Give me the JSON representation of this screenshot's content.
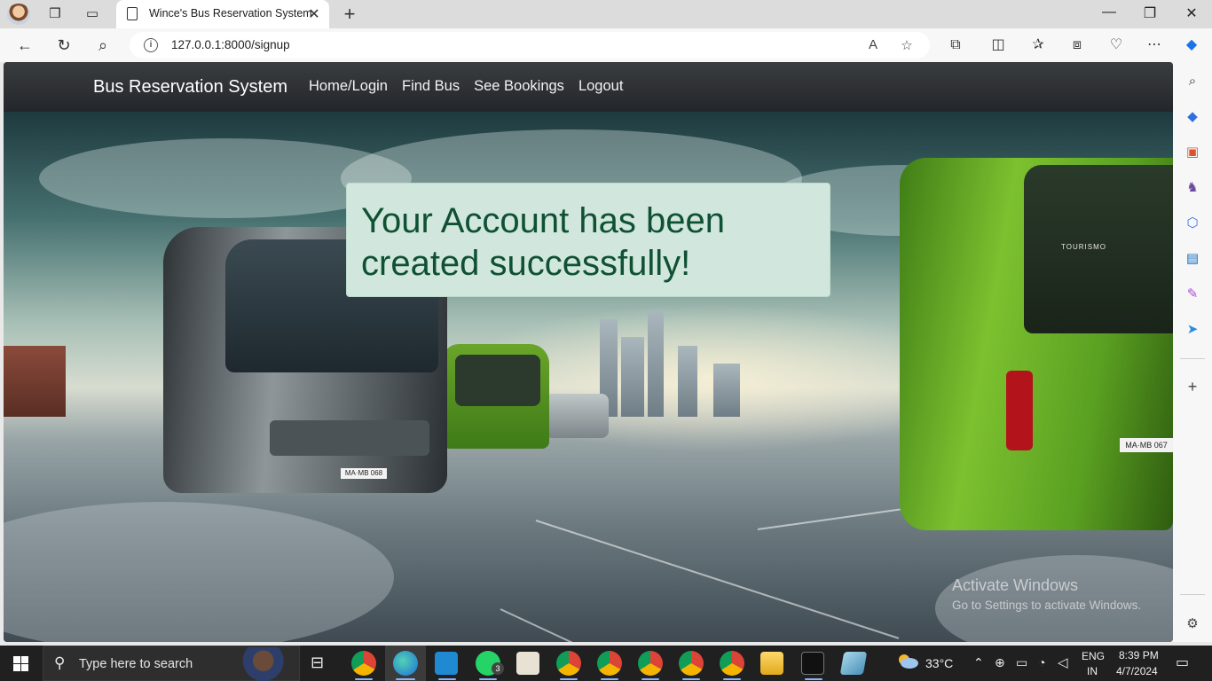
{
  "browser": {
    "tab_title": "Wince's Bus Reservation System",
    "tab_close": "✕",
    "new_tab": "+",
    "url": "127.0.0.1:8000/signup",
    "window_controls": {
      "minimize": "—",
      "restore": "❐",
      "close": "✕"
    }
  },
  "site": {
    "brand": "Bus Reservation System",
    "nav": [
      "Home/Login",
      "Find Bus",
      "See Bookings",
      "Logout"
    ],
    "alert_message": "Your Account has been created successfully!",
    "alert_colors": {
      "background": "#d1e7dd",
      "text": "#0f5132"
    }
  },
  "hero": {
    "plate_silver": "MA·MB 068",
    "plate_green": "MA·MB 067",
    "bus_model": "TOURISMO"
  },
  "watermark": {
    "line1": "Activate Windows",
    "line2": "Go to Settings to activate Windows."
  },
  "taskbar": {
    "search_placeholder": "Type here to search",
    "whatsapp_badge": "3",
    "temperature": "33°C",
    "language": "ENG",
    "region": "IN",
    "time": "8:39 PM",
    "date": "4/7/2024"
  }
}
